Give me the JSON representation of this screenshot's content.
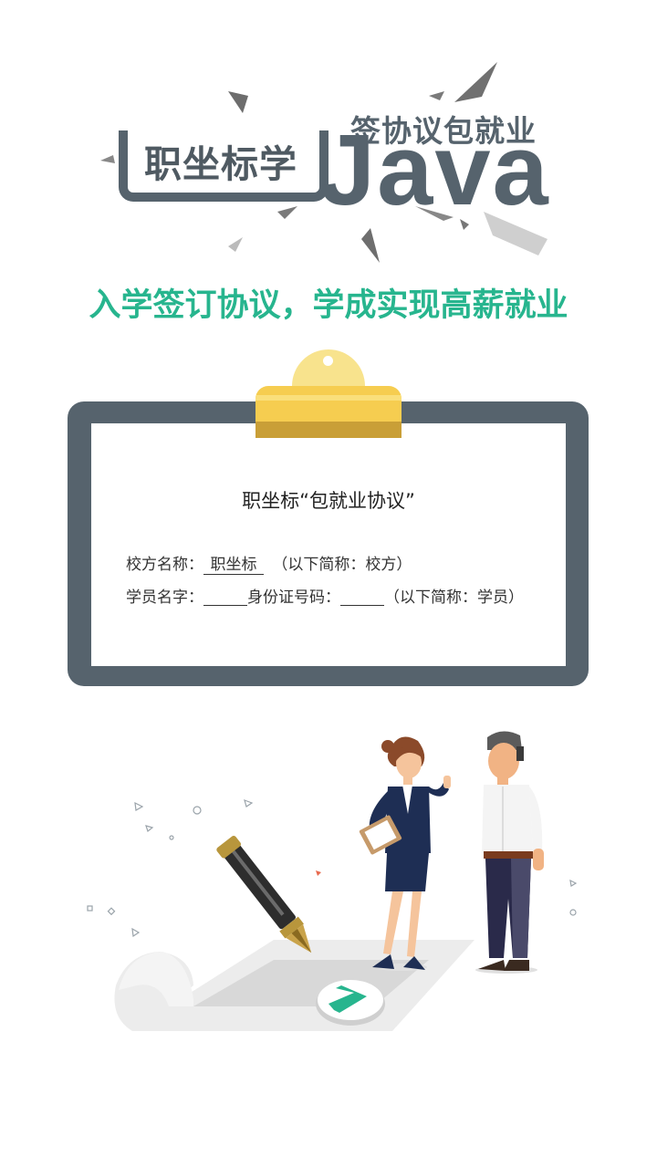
{
  "header": {
    "logo_cn": "职坐标学",
    "logo_slogan": "签协议包就业",
    "logo_java": "Java"
  },
  "tagline": "入学签订协议，学成实现高薪就业",
  "agreement": {
    "title": "职坐标“包就业协议”",
    "school_label": "校方名称：",
    "school_value": "职坐标",
    "school_note": "（以下简称：校方）",
    "student_label": "学员名字：",
    "id_label": "身份证号码：",
    "student_note": "（以下简称：学员）"
  },
  "colors": {
    "accent_green": "#27b58e",
    "board_gray": "#56636d",
    "clip_yellow": "#f6cd50"
  },
  "icons": {
    "go": "chevron-right-icon",
    "pen": "pen-icon"
  }
}
